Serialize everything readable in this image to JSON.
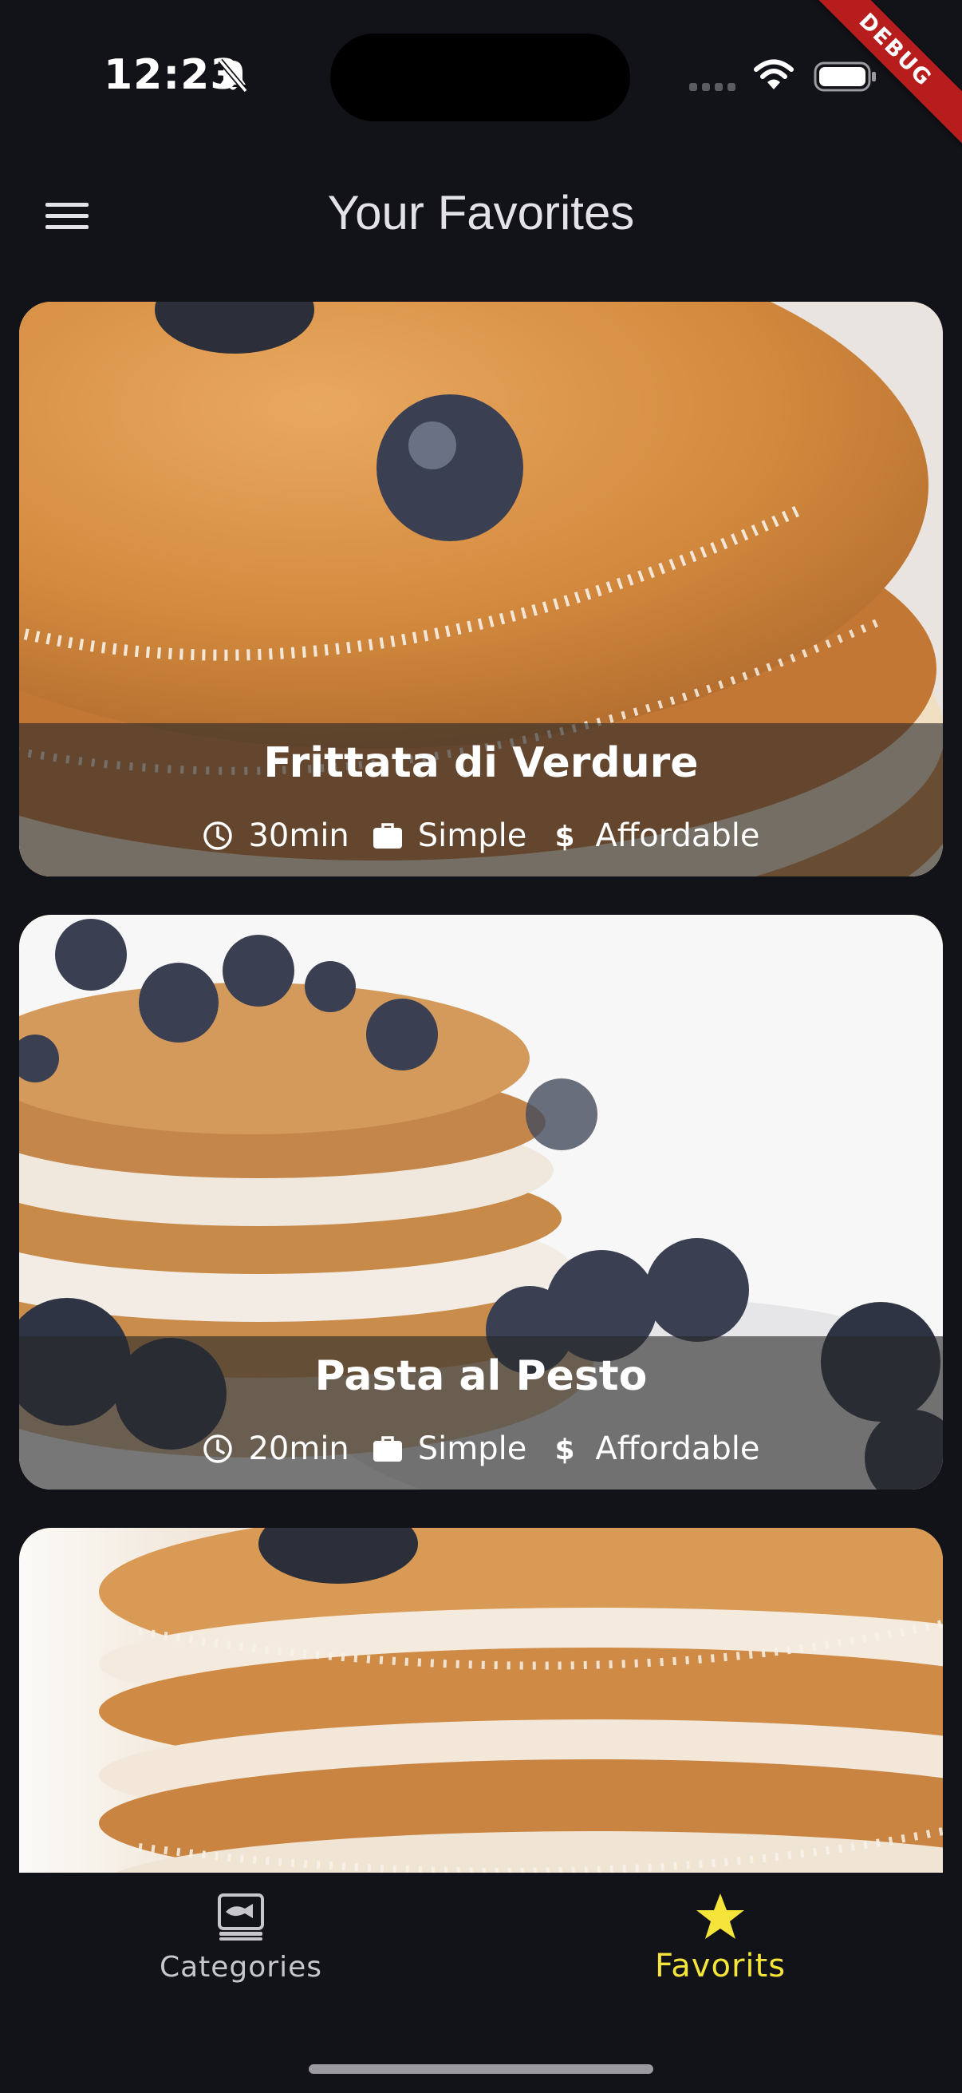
{
  "status_bar": {
    "time": "12:23",
    "debug_label": "DEBUG"
  },
  "app_bar": {
    "title": "Your Favorites",
    "menu_icon": "hamburger-menu-icon"
  },
  "meals": [
    {
      "title": "Frittata di Verdure",
      "duration": "30min",
      "complexity": "Simple",
      "affordability": "Affordable"
    },
    {
      "title": "Pasta al Pesto",
      "duration": "20min",
      "complexity": "Simple",
      "affordability": "Affordable"
    },
    {
      "title": "",
      "duration": "",
      "complexity": "",
      "affordability": ""
    }
  ],
  "bottom_nav": {
    "items": [
      {
        "label": "Categories",
        "icon": "set-meal-icon",
        "active": false
      },
      {
        "label": "Favorits",
        "icon": "star-icon",
        "active": true
      }
    ]
  },
  "colors": {
    "background": "#111318",
    "active_nav": "#f5e43a",
    "inactive_nav": "#c6c6cc",
    "debug_ribbon": "#b71d1d"
  }
}
